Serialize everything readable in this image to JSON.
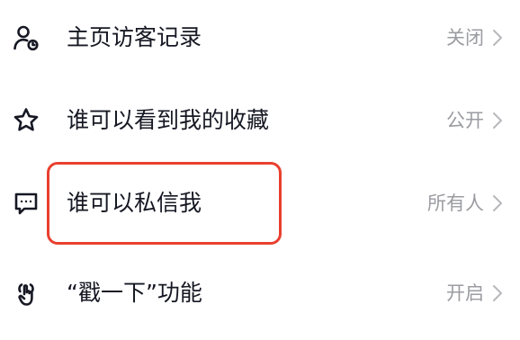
{
  "settings": {
    "rows": [
      {
        "label": "主页访客记录",
        "value": "关闭",
        "icon": "profile-visitor-icon"
      },
      {
        "label": "谁可以看到我的收藏",
        "value": "公开",
        "icon": "star-icon"
      },
      {
        "label": "谁可以私信我",
        "value": "所有人",
        "icon": "message-icon"
      },
      {
        "label": "“戳一下”功能",
        "value": "开启",
        "icon": "poke-hand-icon"
      }
    ]
  },
  "colors": {
    "text": "#161823",
    "value_text": "#9b9ca1",
    "highlight": "#e9402f"
  }
}
